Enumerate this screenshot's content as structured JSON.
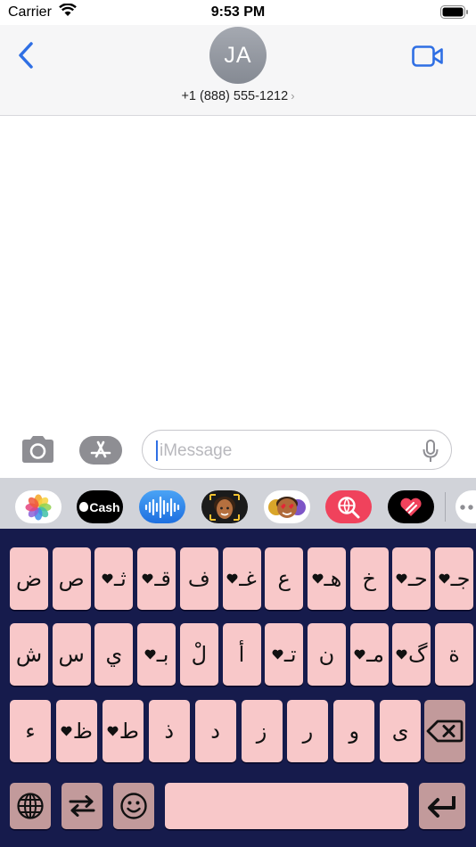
{
  "status_bar": {
    "carrier": "Carrier",
    "time": "9:53 PM"
  },
  "header": {
    "avatar_initials": "JA",
    "phone_number": "+1 (888) 555-1212",
    "chevron": "›"
  },
  "input": {
    "placeholder": "iMessage"
  },
  "app_drawer": {
    "items": [
      {
        "name": "photos-app"
      },
      {
        "name": "apple-cash-app",
        "label": "Cash"
      },
      {
        "name": "audio-message-app"
      },
      {
        "name": "memoji-app"
      },
      {
        "name": "animoji-stickers-app"
      },
      {
        "name": "images-search-app"
      },
      {
        "name": "digital-touch-app"
      },
      {
        "name": "more-apps"
      }
    ]
  },
  "keyboard": {
    "rows": [
      [
        "ض",
        "ص",
        "ثـ",
        "قـ",
        "ف",
        "غـ",
        "ع",
        "هـ",
        "خ",
        "حـ",
        "جـ"
      ],
      [
        "ش",
        "س",
        "ي",
        "بـ",
        "لْ",
        "أ",
        "تـ",
        "ن",
        "مـ",
        "گ",
        "ة"
      ],
      [
        "ء",
        "ظ",
        "ط",
        "ذ",
        "د",
        "ز",
        "ر",
        "و",
        "ى"
      ]
    ],
    "heart_keys": [
      "ثـ",
      "قـ",
      "غـ",
      "هـ",
      "حـ",
      "جـ",
      "بـ",
      "تـ",
      "مـ",
      "گ",
      "ظ",
      "ط"
    ]
  },
  "colors": {
    "keyboard_bg": "#161b4c",
    "key": "#f8c8c9",
    "key_special": "#c29a9b",
    "accent": "#2f6fe4"
  }
}
